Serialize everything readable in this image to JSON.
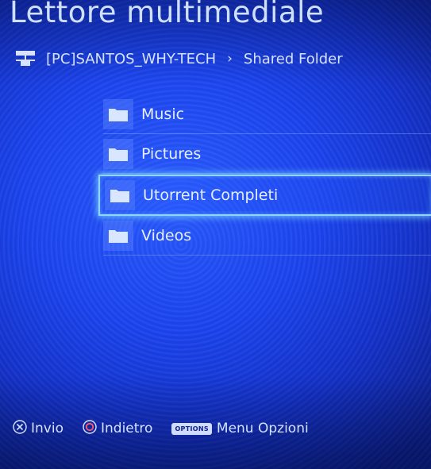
{
  "header": {
    "title": "Lettore multimediale"
  },
  "breadcrumb": {
    "server": "[PC]SANTOS_WHY-TECH",
    "separator": "›",
    "folder": "Shared Folder"
  },
  "folders": [
    {
      "label": "Music",
      "selected": false
    },
    {
      "label": "Pictures",
      "selected": false
    },
    {
      "label": "Utorrent Completi",
      "selected": true
    },
    {
      "label": "Videos",
      "selected": false
    }
  ],
  "footer": {
    "enter_label": "Invio",
    "back_label": "Indietro",
    "options_badge": "OPTIONS",
    "options_label": "Menu Opzioni"
  },
  "colors": {
    "background": "#1c45f0",
    "selection_glow": "#8fd6ff",
    "text": "#e6eeff"
  }
}
